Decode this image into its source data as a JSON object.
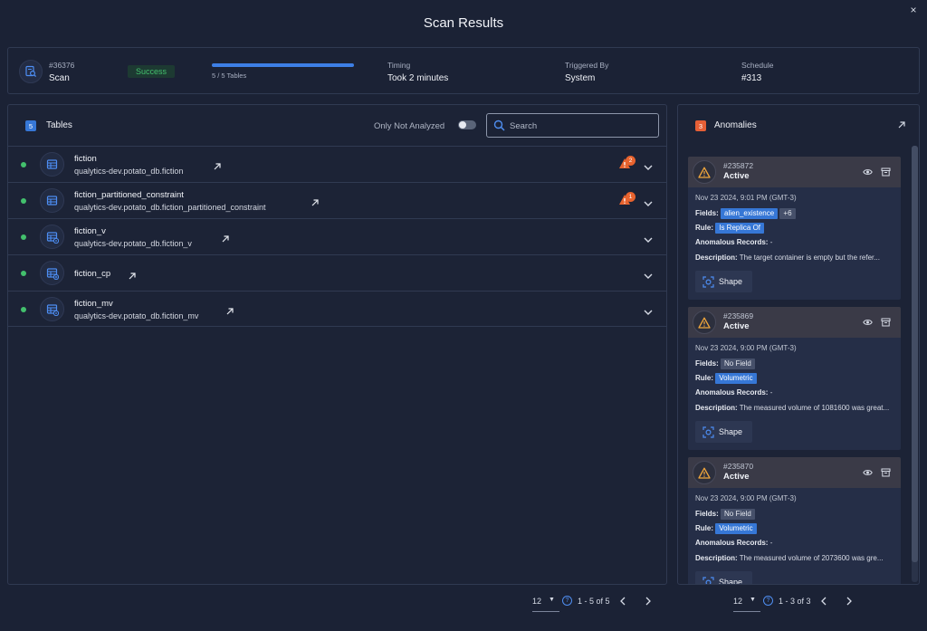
{
  "dialog": {
    "title": "Scan Results",
    "close_label": "×"
  },
  "summary": {
    "scan_id": "#36376",
    "scan_label": "Scan",
    "status": "Success",
    "progress_text": "5 / 5 Tables",
    "progress_fraction": 1.0,
    "timing_label": "Timing",
    "timing_value": "Took 2 minutes",
    "triggered_label": "Triggered By",
    "triggered_value": "System",
    "schedule_label": "Schedule",
    "schedule_value": "#313"
  },
  "tables_panel": {
    "count": "5",
    "title": "Tables",
    "toggle_label": "Only Not Analyzed",
    "toggle_on": false,
    "search_placeholder": "Search",
    "rows": [
      {
        "name": "fiction",
        "path": "qualytics-dev.potato_db.fiction",
        "anomalies": "2",
        "icon": "table-icon"
      },
      {
        "name": "fiction_partitioned_constraint",
        "path": "qualytics-dev.potato_db.fiction_partitioned_constraint",
        "anomalies": "1",
        "icon": "table-icon"
      },
      {
        "name": "fiction_v",
        "path": "qualytics-dev.potato_db.fiction_v",
        "anomalies": "",
        "icon": "view-icon"
      },
      {
        "name": "fiction_cp",
        "path": "",
        "anomalies": "",
        "icon": "computed-table-icon"
      },
      {
        "name": "fiction_mv",
        "path": "qualytics-dev.potato_db.fiction_mv",
        "anomalies": "",
        "icon": "view-icon"
      }
    ],
    "pager": {
      "page_size": "12",
      "range": "1 - 5 of 5"
    }
  },
  "anomalies_panel": {
    "count": "3",
    "title": "Anomalies",
    "labels": {
      "fields": "Fields:",
      "rule": "Rule:",
      "records": "Anomalous Records:",
      "description": "Description:",
      "shape": "Shape"
    },
    "cards": [
      {
        "id": "#235872",
        "status": "Active",
        "timestamp": "Nov 23 2024, 9:01 PM (GMT-3)",
        "field": "alien_existence",
        "extra_fields": "+6",
        "rule": "Is Replica Of",
        "records": "-",
        "description": "The target container is empty but the refer..."
      },
      {
        "id": "#235869",
        "status": "Active",
        "timestamp": "Nov 23 2024, 9:00 PM (GMT-3)",
        "field": "No Field",
        "extra_fields": "",
        "rule": "Volumetric",
        "records": "-",
        "description": "The measured volume of 1081600 was great..."
      },
      {
        "id": "#235870",
        "status": "Active",
        "timestamp": "Nov 23 2024, 9:00 PM (GMT-3)",
        "field": "No Field",
        "extra_fields": "",
        "rule": "Volumetric",
        "records": "-",
        "description": "The measured volume of 2073600 was gre..."
      }
    ],
    "pager": {
      "page_size": "12",
      "range": "1 - 3 of 3"
    }
  },
  "colors": {
    "background": "#1b2235",
    "accent": "#3677d6",
    "success": "#43c06d",
    "warning": "#e8632e"
  }
}
